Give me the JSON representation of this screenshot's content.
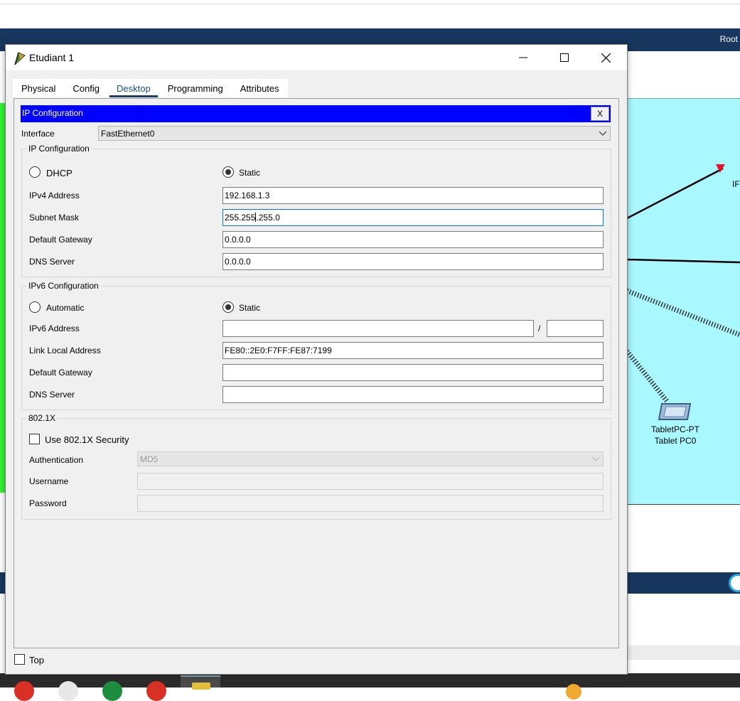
{
  "background": {
    "app_title": "Root",
    "device_label_1": "TabletPC-PT",
    "device_label_2": "Tablet PC0",
    "edge_label": "IF"
  },
  "window": {
    "title": "Etudiant 1",
    "app_icon": "packet-tracer-icon"
  },
  "tabs": [
    {
      "label": "Physical"
    },
    {
      "label": "Config"
    },
    {
      "label": "Desktop",
      "active": true
    },
    {
      "label": "Programming"
    },
    {
      "label": "Attributes"
    }
  ],
  "ip_config": {
    "header": "IP Configuration",
    "close_label": "X",
    "interface_label": "Interface",
    "interface_value": "FastEthernet0",
    "ipv4": {
      "group_title": "IP Configuration",
      "dhcp_label": "DHCP",
      "static_label": "Static",
      "mode": "Static",
      "address_label": "IPv4 Address",
      "address_value": "192.168.1.3",
      "mask_label": "Subnet Mask",
      "mask_value_a": "255.255",
      "mask_value_b": ".255.0",
      "gateway_label": "Default Gateway",
      "gateway_value": "0.0.0.0",
      "dns_label": "DNS Server",
      "dns_value": "0.0.0.0"
    },
    "ipv6": {
      "group_title": "IPv6 Configuration",
      "auto_label": "Automatic",
      "static_label": "Static",
      "mode": "Static",
      "address_label": "IPv6 Address",
      "address_value": "",
      "prefix_sep": "/",
      "prefix_value": "",
      "link_local_label": "Link Local Address",
      "link_local_value": "FE80::2E0:F7FF:FE87:7199",
      "gateway_label": "Default Gateway",
      "gateway_value": "",
      "dns_label": "DNS Server",
      "dns_value": ""
    },
    "dot1x": {
      "group_title": "802.1X",
      "use_label": "Use 802.1X Security",
      "use_checked": false,
      "auth_label": "Authentication",
      "auth_value": "MD5",
      "username_label": "Username",
      "username_value": "",
      "password_label": "Password",
      "password_value": ""
    }
  },
  "footer": {
    "top_label": "Top",
    "top_checked": false
  }
}
